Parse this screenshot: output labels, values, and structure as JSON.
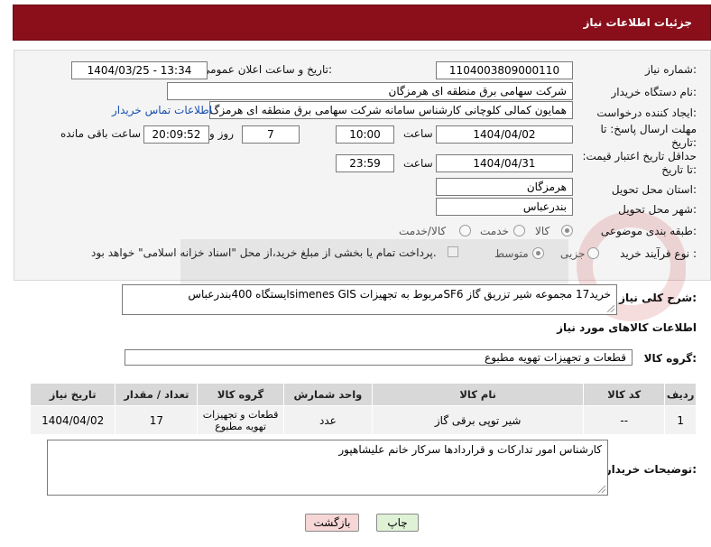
{
  "header": {
    "title": "جزئیات اطلاعات نیاز"
  },
  "labels": {
    "need_number": "شماره نیاز:",
    "announce_datetime": "تاریخ و ساعت اعلان عمومی:",
    "buyer_org": "نام دستگاه خریدار:",
    "requester": "ایجاد کننده درخواست:",
    "reply_deadline": "مهلت ارسال پاسخ: تا تاریخ:",
    "hour": "ساعت",
    "day_and": "روز و",
    "hours_remaining": "ساعت باقی مانده",
    "price_validity": "حداقل تاریخ اعتبار قیمت: تا تاریخ:",
    "delivery_province": "استان محل تحویل:",
    "delivery_city": "شهر محل تحویل:",
    "category": "طبقه بندی موضوعی:",
    "purchase_type": "نوع فرآیند خرید :",
    "need_description": "شرح کلی نیاز:",
    "goods_info": "اطلاعات کالاهای مورد نیاز",
    "goods_group": "گروه کالا:",
    "buyer_notes": "توضیحات خریدار:"
  },
  "fields": {
    "need_number": "1104003809000110",
    "announce_datetime": "1404/03/25 - 13:34",
    "buyer_org": "شرکت سهامی برق منطقه ای هرمزگان",
    "requester": "همایون کمالی کلوچانی کارشناس سامانه شرکت سهامی برق منطقه ای هرمزگ",
    "buyer_contact_link": "اطلاعات تماس خریدار",
    "reply_date": "1404/04/02",
    "reply_time": "10:00",
    "days_remaining": "7",
    "time_remaining": "20:09:52",
    "price_date": "1404/04/31",
    "price_time": "23:59",
    "province": "هرمزگان",
    "city": "بندرعباس",
    "need_description": "خرید17 مجموعه شیر تزریق گاز SF6مربوط به تجهیزات simenes GISایستگاه 400بندرعباس",
    "goods_group": "قطعات و تجهیزات تهویه مطبوع",
    "buyer_notes": "کارشناس امور تدارکات و قراردادها سرکار خانم علیشاهپور"
  },
  "category_options": [
    {
      "label": "کالا",
      "selected": true
    },
    {
      "label": "خدمت",
      "selected": false
    },
    {
      "label": "کالا/خدمت",
      "selected": false
    }
  ],
  "purchase_options": [
    {
      "label": "جزیی",
      "selected": false
    },
    {
      "label": "متوسط",
      "selected": true
    }
  ],
  "payment_note": "پرداخت تمام یا بخشی از مبلغ خرید،از محل \"اسناد خزانه اسلامی\" خواهد بود.",
  "table": {
    "headers": [
      "ردیف",
      "کد کالا",
      "نام کالا",
      "واحد شمارش",
      "گروه کالا",
      "تعداد / مقدار",
      "تاریخ نیاز"
    ],
    "rows": [
      [
        "1",
        "--",
        "شیر توپی برقی گاز",
        "عدد",
        "قطعات و تجهیزات تهویه مطبوع",
        "17",
        "1404/04/02"
      ]
    ]
  },
  "buttons": {
    "print": "چاپ",
    "back": "بازگشت"
  },
  "colors": {
    "header_bg": "#8b0f1b",
    "back_button_bg": "#f6d6d6",
    "print_button_bg": "#dff2d6"
  }
}
